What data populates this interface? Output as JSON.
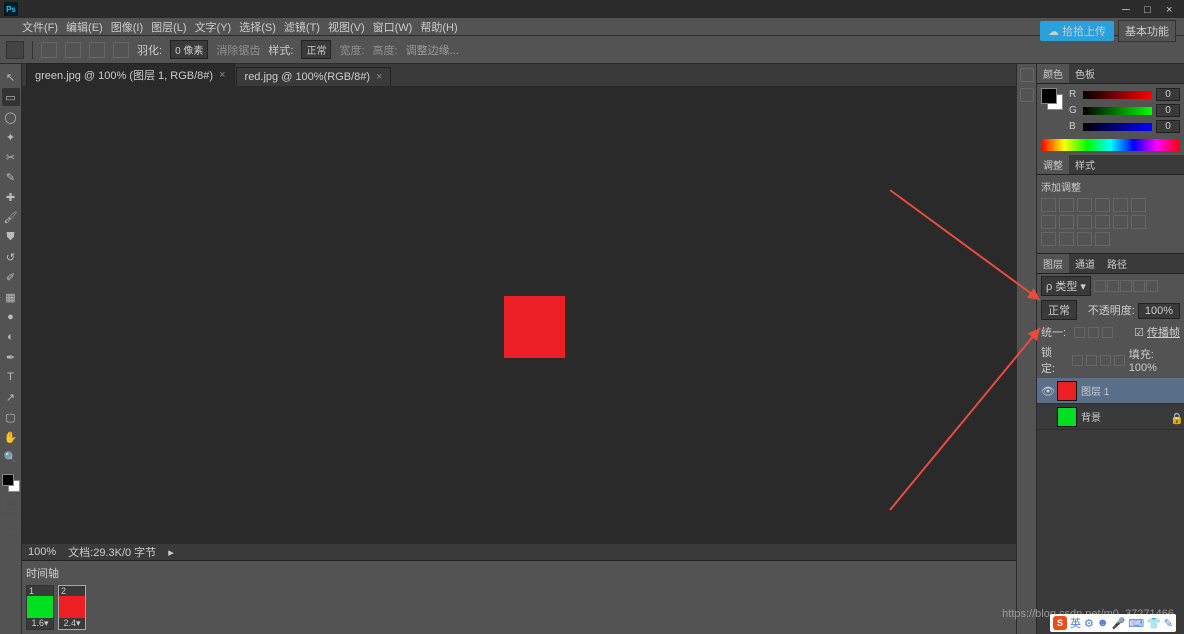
{
  "menu": {
    "file": "文件(F)",
    "edit": "编辑(E)",
    "image": "图像(I)",
    "layer": "图层(L)",
    "text": "文字(Y)",
    "select": "选择(S)",
    "filter": "滤镜(T)",
    "view": "视图(V)",
    "window": "窗口(W)",
    "help": "帮助(H)"
  },
  "opt": {
    "feather_label": "羽化:",
    "feather_val": "0 像素",
    "antialias": "消除锯齿",
    "style_label": "样式:",
    "style_val": "正常",
    "width": "宽度:",
    "height": "高度:",
    "cxc": "调整边缘..."
  },
  "topright": {
    "upload": "拾拾上传",
    "essentials": "基本功能"
  },
  "tabs": [
    {
      "label": "green.jpg @ 100% (图层 1, RGB/8#)",
      "active": true
    },
    {
      "label": "red.jpg @ 100%(RGB/8#)",
      "active": false
    }
  ],
  "status": {
    "zoom": "100%",
    "doc": "文档:29.3K/0 字节"
  },
  "timeline": {
    "title": "时间轴",
    "frames": [
      {
        "idx": "1",
        "color": "#00e020",
        "dur": "1.6",
        "sel": false
      },
      {
        "idx": "2",
        "color": "#ec2024",
        "dur": "2.4",
        "sel": true
      }
    ]
  },
  "panels": {
    "color_tab": "颜色",
    "swatches_tab": "色板",
    "rgb": {
      "r": "0",
      "g": "0",
      "b": "0"
    },
    "adjust_tab": "调整",
    "style_tab": "样式",
    "add_adjust": "添加调整",
    "layers_tab": "图层",
    "channels_tab": "通道",
    "paths_tab": "路径",
    "kind": "类型",
    "blend": "正常",
    "opacity_label": "不透明度:",
    "opacity_val": "100%",
    "row3": "统一:",
    "link_label": "传播帧",
    "lock_label": "锁定:",
    "fill_label": "填充:",
    "fill_val": "100%",
    "layers": [
      {
        "name": "图层 1",
        "color": "#ec2024",
        "sel": true,
        "locked": false,
        "visible": true
      },
      {
        "name": "背景",
        "color": "#00e020",
        "sel": false,
        "locked": true,
        "visible": false
      }
    ]
  },
  "watermark": "https://blog.csdn.net/m0_37271466",
  "ime": {
    "badge": "S",
    "lang": "英"
  }
}
